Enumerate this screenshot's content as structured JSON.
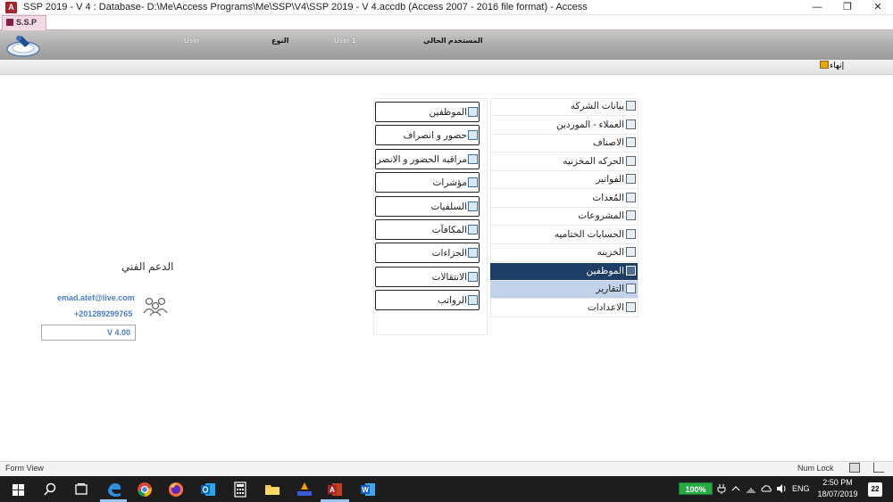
{
  "window": {
    "title": "SSP 2019 - V 4 : Database- D:\\Me\\Access Programs\\Me\\SSP\\V4\\SSP 2019 - V 4.accdb (Access 2007 - 2016 file format) - Access",
    "app_icon_letter": "A",
    "minimize_glyph": "—",
    "maximize_glyph": "❐",
    "close_glyph": "✕"
  },
  "tab": {
    "label": "S.S.P"
  },
  "header": {
    "user_label": "User",
    "type_label": "النوع",
    "user_value": "User 1",
    "current_user_label": "المستخدم الحالي"
  },
  "toolbar": {
    "logout_label": "إنهاء"
  },
  "main_menu": {
    "items": [
      {
        "label": "بيانات الشركه",
        "icon": "grid-icon"
      },
      {
        "label": "العملاء - الموردين",
        "icon": "contacts-icon"
      },
      {
        "label": "الاصناف",
        "icon": "list-icon"
      },
      {
        "label": "الحركه المخزنيه",
        "icon": "warehouse-icon"
      },
      {
        "label": "الفواتير",
        "icon": "invoice-icon"
      },
      {
        "label": "المُعدات",
        "icon": "equipment-icon"
      },
      {
        "label": "المشروعات",
        "icon": "home-icon"
      },
      {
        "label": "الحسابات الختاميه",
        "icon": "accounts-icon"
      },
      {
        "label": "الخزينه",
        "icon": "pin-icon"
      },
      {
        "label": "الموظفين",
        "icon": "employees-icon"
      },
      {
        "label": "التقارير",
        "icon": "chart-icon"
      },
      {
        "label": "الاعدادات",
        "icon": "tools-icon"
      }
    ],
    "active_index": 9,
    "hover_index": 10
  },
  "sub_menu": {
    "items": [
      "الموظفين",
      "حضور و انصراف",
      "مراقبه الحضور و الانصراف",
      "مؤشرات",
      "السلفيات",
      "المكافآت",
      "الجزاءات",
      "الانتقالات",
      "الرواتب"
    ]
  },
  "support": {
    "title": "الدعم الفني",
    "email": "emad.atef@live.com",
    "phone": "+201289299765",
    "version": "V 4.00"
  },
  "status_bar": {
    "view_label": "Form View",
    "num_lock": "Num Lock"
  },
  "taskbar": {
    "battery": "100%",
    "language": "ENG",
    "time": "2:50 PM",
    "date": "18/07/2019",
    "notifications": "22"
  },
  "colors": {
    "active_menu_bg": "#1f3e66",
    "hover_menu_bg": "#c2d2ea",
    "link_blue": "#4a7fc1",
    "tab_bg": "#f5d9e6",
    "taskbar_bg": "#1d1d1d"
  }
}
